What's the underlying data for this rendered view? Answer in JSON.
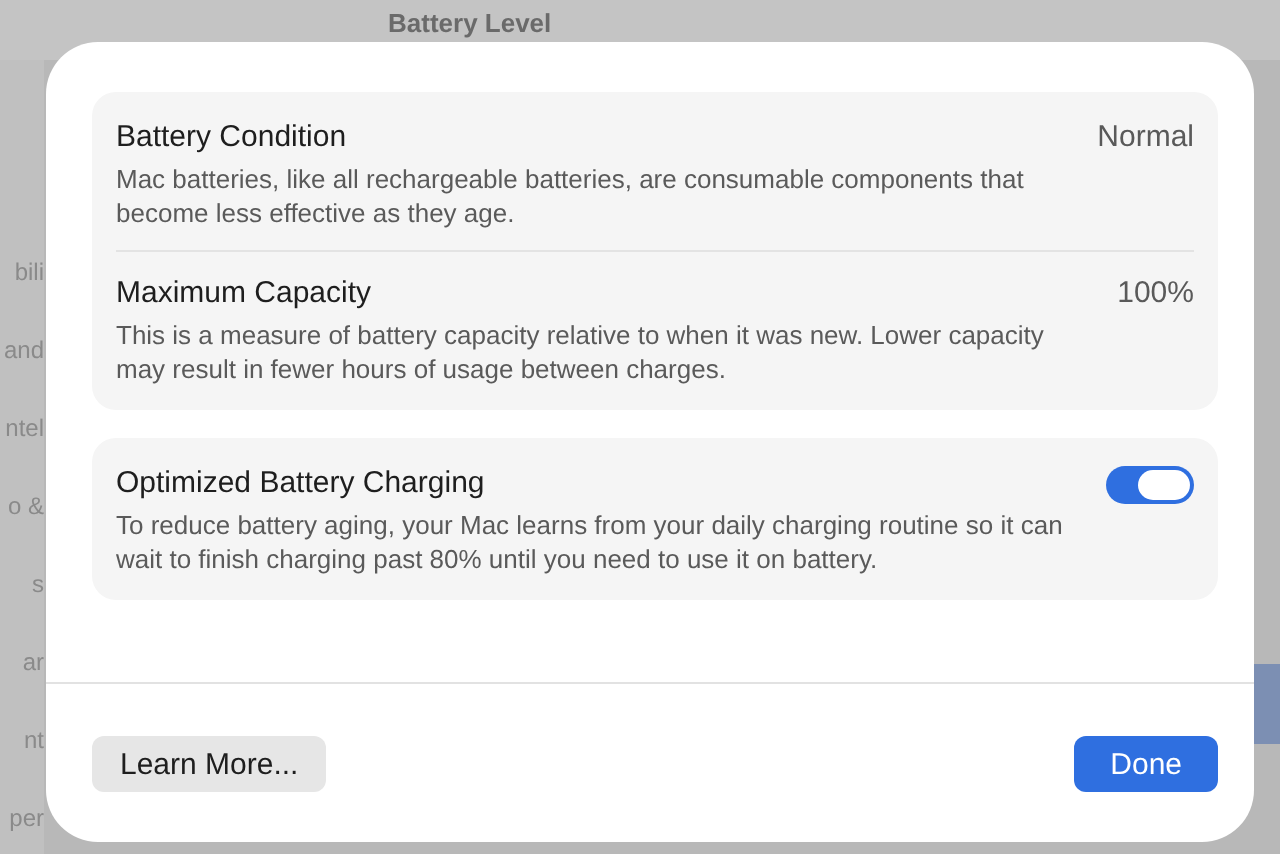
{
  "background_window": {
    "title": "Battery Level",
    "sidebar_items": [
      "bili",
      "and",
      "ntel",
      "o &",
      "s",
      "ar",
      "nt",
      "per"
    ]
  },
  "sheet": {
    "sections": [
      {
        "items": [
          {
            "kind": "value",
            "title": "Battery Condition",
            "description": "Mac batteries, like all rechargeable batteries, are consumable components that become less effective as they age.",
            "value": "Normal"
          },
          {
            "kind": "value",
            "title": "Maximum Capacity",
            "description": "This is a measure of battery capacity relative to when it was new. Lower capacity may result in fewer hours of usage between charges.",
            "value": "100%"
          }
        ]
      },
      {
        "items": [
          {
            "kind": "toggle",
            "title": "Optimized Battery Charging",
            "description": "To reduce battery aging, your Mac learns from your daily charging routine so it can wait to finish charging past 80% until you need to use it on battery.",
            "on": true
          }
        ]
      }
    ],
    "buttons": [
      {
        "label": "Learn More...",
        "kind": "secondary"
      },
      {
        "label": "Done",
        "kind": "primary"
      }
    ]
  }
}
